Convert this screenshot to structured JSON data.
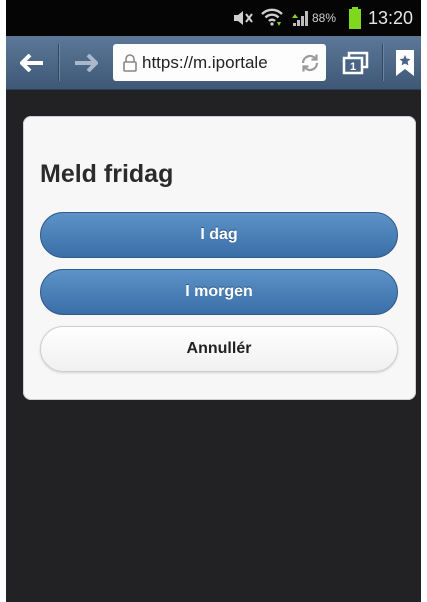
{
  "status_bar": {
    "battery_percent": "88%",
    "clock": "13:20",
    "icons": [
      "mute-icon",
      "wifi-icon",
      "signal-icon",
      "battery-icon"
    ],
    "battery_color": "#7dd81e"
  },
  "browser": {
    "url": "https://m.iportale",
    "tab_count": "1",
    "icons": [
      "back-arrow-icon",
      "forward-arrow-icon",
      "lock-icon",
      "refresh-icon",
      "tabs-icon",
      "bookmark-icon"
    ]
  },
  "dialog": {
    "title": "Meld fridag",
    "buttons": {
      "today": "I dag",
      "tomorrow": "I morgen",
      "cancel": "Annullér"
    },
    "accent_color": "#4a80b8"
  }
}
